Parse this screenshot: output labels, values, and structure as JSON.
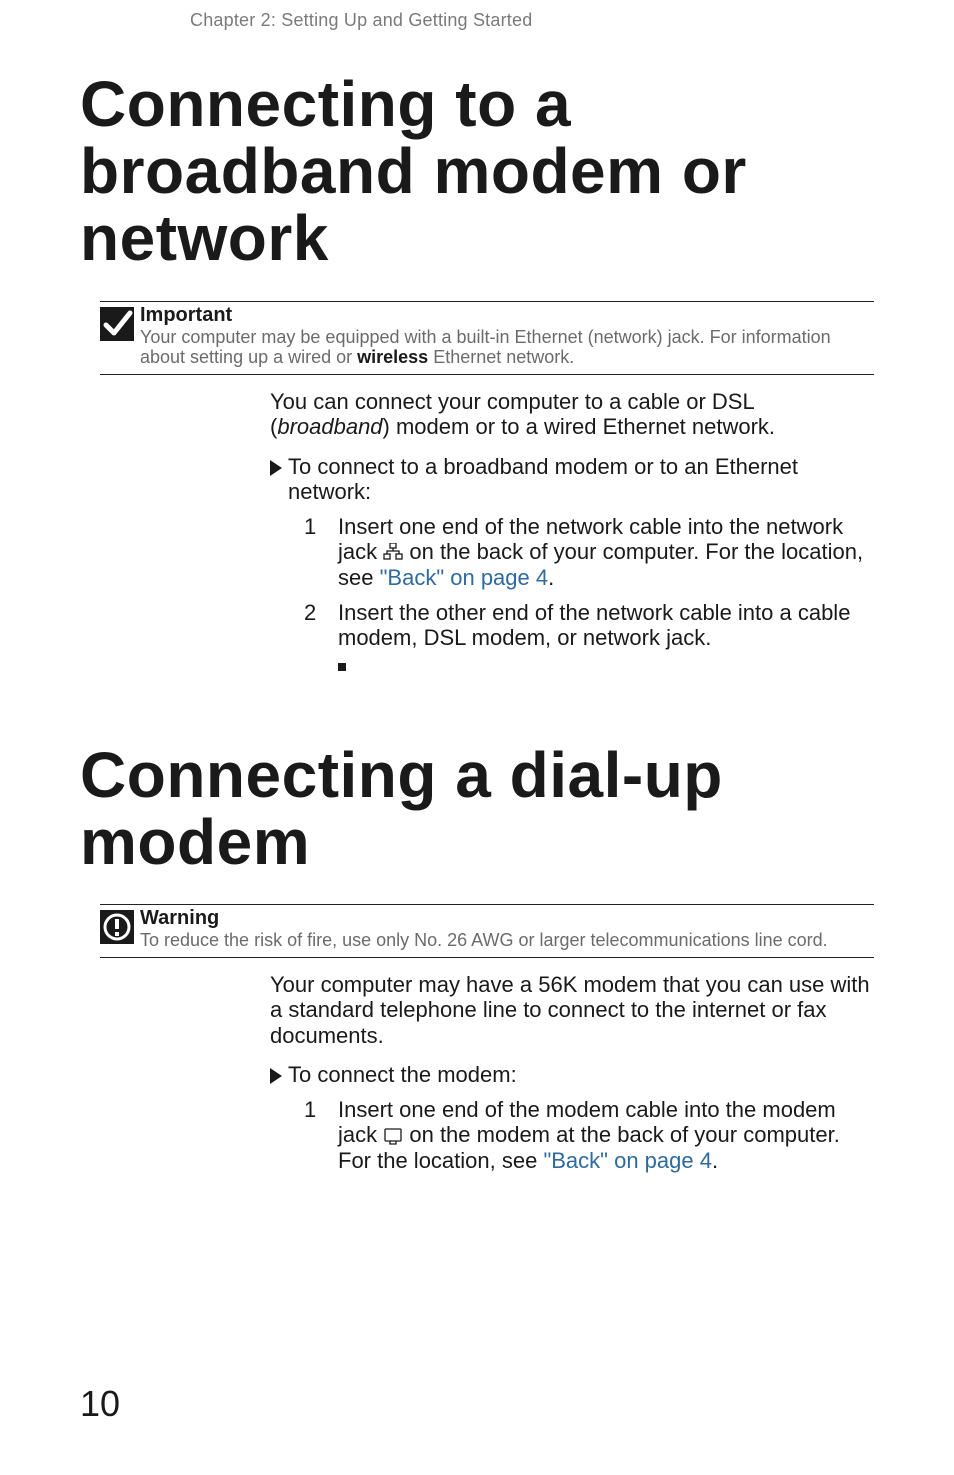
{
  "running_head": "Chapter 2: Setting Up and Getting Started",
  "section1": {
    "title": "Connecting to a broadband modem or network",
    "callout": {
      "label": "Important",
      "text_before_strong": "Your computer may be equipped with a built-in Ethernet (network) jack. For information about setting up a wired or ",
      "strong": "wireless",
      "text_after_strong": " Ethernet network."
    },
    "intro_before_italic": "You can connect your computer to a cable or DSL (",
    "intro_italic": "broadband",
    "intro_after_italic": ") modem or to a wired Ethernet network.",
    "proc_head": "To connect to a broadband modem or to an Ethernet network:",
    "steps": {
      "s1_num": "1",
      "s1_before_icon": "Insert one end of the network cable into the network jack ",
      "s1_after_icon_before_link": " on the back of your computer. For the location, see ",
      "s1_link": "\"Back\" on page 4",
      "s1_after_link": ".",
      "s2_num": "2",
      "s2_text": "Insert the other end of the network cable into a cable modem, DSL modem, or network jack."
    }
  },
  "section2": {
    "title": "Connecting a dial-up modem",
    "callout": {
      "label": "Warning",
      "text": "To reduce the risk of fire, use only No. 26 AWG or larger telecommunications line cord."
    },
    "intro": "Your computer may have a 56K modem that you can use with a standard telephone line to connect to the internet or fax documents.",
    "proc_head": "To connect the modem:",
    "steps": {
      "s1_num": "1",
      "s1_before_icon": "Insert one end of the modem cable into the modem jack ",
      "s1_after_icon_before_link": " on the modem at the back of your computer. For the location, see ",
      "s1_link": "\"Back\" on page 4",
      "s1_after_link": "."
    }
  },
  "page_number": "10"
}
